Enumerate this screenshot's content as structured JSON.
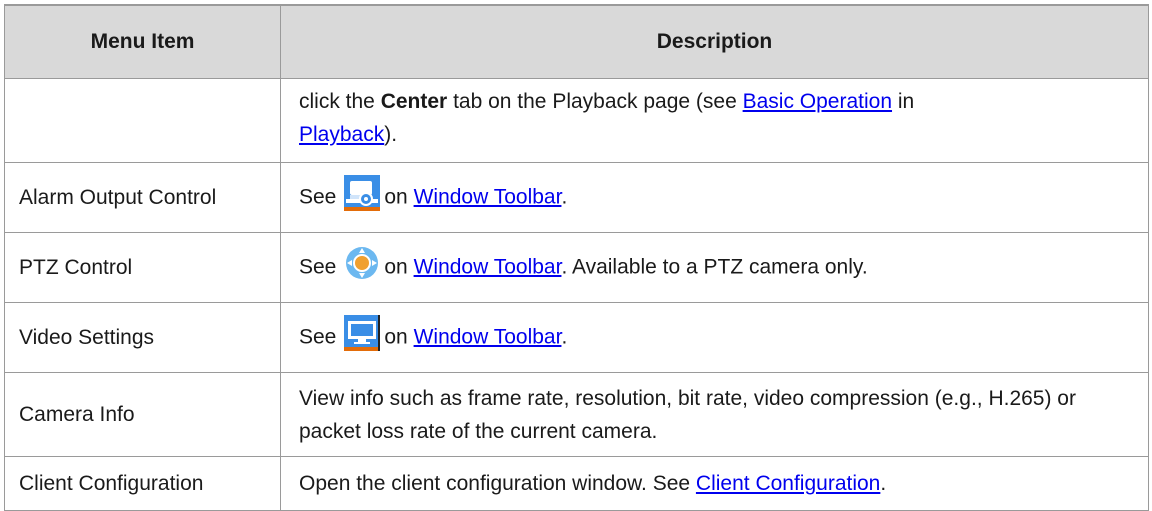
{
  "table": {
    "headers": [
      "Menu Item",
      "Description"
    ],
    "rows": [
      {
        "item": "",
        "desc": {
          "p1": "click the ",
          "bold": "Center",
          "p2": " tab on the Playback page (see ",
          "link1": "Basic Operation",
          "p3": " in ",
          "link2": "Playback",
          "p4": ")."
        }
      },
      {
        "item": "Alarm Output Control",
        "desc": {
          "see": "See",
          "icon": "alarm-output-icon",
          "on": "on",
          "link": "Window Toolbar",
          "tail": "."
        }
      },
      {
        "item": "PTZ Control",
        "desc": {
          "see": "See",
          "icon": "ptz-control-icon",
          "on": "on",
          "link": "Window Toolbar",
          "tail": ". Available to a PTZ camera only."
        }
      },
      {
        "item": "Video Settings",
        "desc": {
          "see": "See",
          "icon": "monitor-icon",
          "on": "on",
          "link": "Window Toolbar",
          "tail": "."
        }
      },
      {
        "item": "Camera Info",
        "desc": {
          "text": "View info such as frame rate, resolution, bit rate, video compression (e.g., H.265) or packet loss rate of the current camera."
        }
      },
      {
        "item": "Client Configuration",
        "desc": {
          "p1": "Open the client configuration window. See ",
          "link": "Client Configuration",
          "tail": "."
        }
      }
    ]
  }
}
